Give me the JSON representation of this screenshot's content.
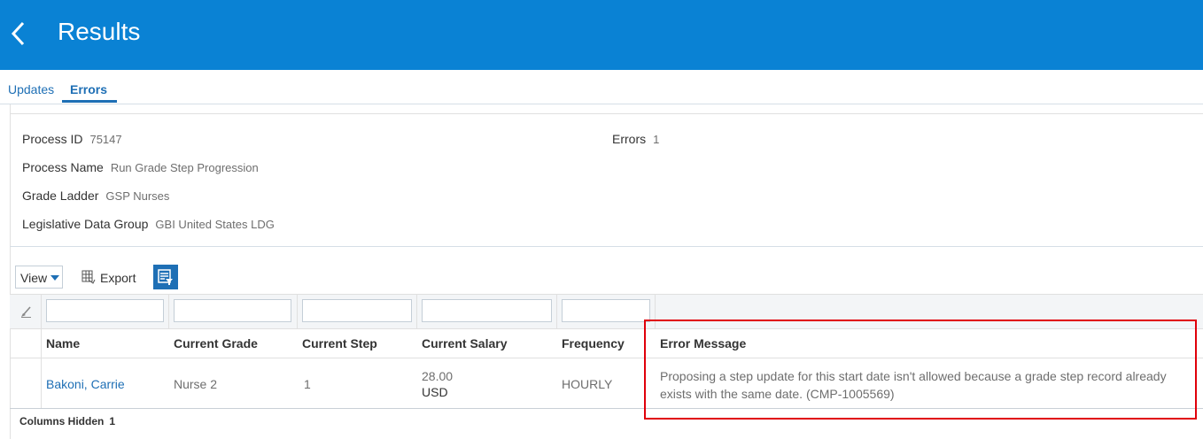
{
  "header": {
    "title": "Results",
    "back_icon": "chevron-left-icon",
    "bg_color": "#0a82d4"
  },
  "tabs": [
    {
      "label": "Updates",
      "active": false
    },
    {
      "label": "Errors",
      "active": true
    }
  ],
  "process": {
    "process_id_label": "Process ID",
    "process_id": "75147",
    "process_name_label": "Process Name",
    "process_name": "Run Grade Step Progression",
    "grade_ladder_label": "Grade Ladder",
    "grade_ladder": "GSP Nurses",
    "ldg_label": "Legislative Data Group",
    "ldg": "GBI United States LDG",
    "errors_label": "Errors",
    "errors": "1"
  },
  "toolbar": {
    "view_label": "View",
    "export_label": "Export",
    "export_icon": "export-spreadsheet-icon",
    "filter_icon": "query-by-example-icon"
  },
  "table": {
    "columns": [
      "Name",
      "Current Grade",
      "Current Step",
      "Current Salary",
      "Frequency",
      "Error Message"
    ],
    "rows": [
      {
        "name": "Bakoni, Carrie",
        "current_grade": "Nurse 2",
        "current_step": "1",
        "salary_amount": "28.00",
        "salary_currency": "USD",
        "frequency": "HOURLY",
        "error_message": "Proposing a step update for this start date isn't allowed because a grade step record already exists with the same date. (CMP-1005569)"
      }
    ]
  },
  "footer": {
    "columns_hidden_label": "Columns Hidden",
    "columns_hidden": "1"
  },
  "highlight_color": "#e0000a"
}
